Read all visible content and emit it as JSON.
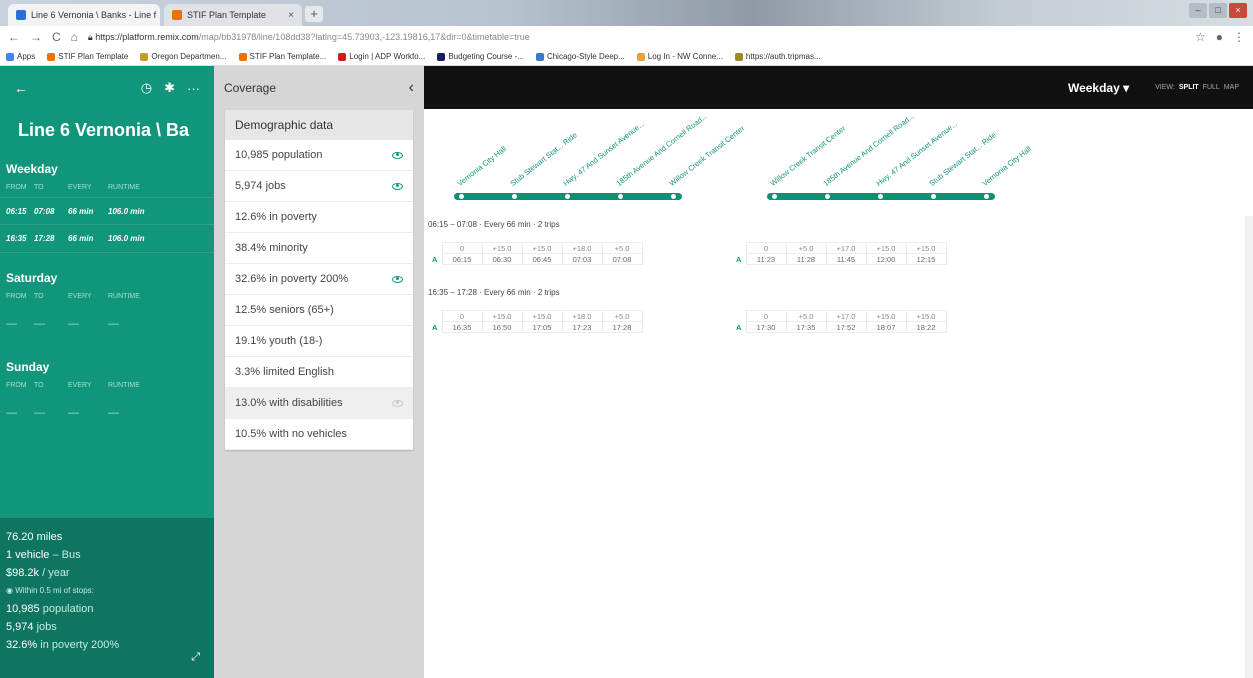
{
  "browser": {
    "tabs": [
      {
        "label": "Line 6 Vernonia \\ Banks - Line f",
        "close": "×"
      },
      {
        "label": "STIF Plan Template",
        "close": "×"
      }
    ],
    "new_tab": "+",
    "window_controls": [
      "–",
      "□",
      "×"
    ],
    "nav": {
      "back": "←",
      "forward": "→",
      "reload": "C",
      "home": "⌂"
    },
    "url_host": "https://platform.remix.com",
    "url_path": "/map/bb31978/line/108dd38?latlng=45.73903,-123.19816,17&dir=0&timetable=true",
    "bookmarks": [
      {
        "label": "Apps",
        "color": "#4285f4"
      },
      {
        "label": "STIF Plan Template",
        "color": "#e8710a"
      },
      {
        "label": "Oregon Departmen...",
        "color": "#c99a2e"
      },
      {
        "label": "STIF Plan Template...",
        "color": "#e8710a"
      },
      {
        "label": "Login | ADP Workfo...",
        "color": "#d01c1c"
      },
      {
        "label": "Budgeting Course -...",
        "color": "#1a1a66"
      },
      {
        "label": "Chicago-Style Deep...",
        "color": "#3b7bbf"
      },
      {
        "label": "Log In - NW Conne...",
        "color": "#e8a03a"
      },
      {
        "label": "https://auth.tripmas...",
        "color": "#9a8a2a"
      }
    ]
  },
  "left_panel": {
    "back_icon": "←",
    "clock_icon": "◷",
    "gear_icon": "✱",
    "more_icon": "···",
    "line_title": "Line 6 Vernonia \\ Ba",
    "columns": {
      "from": "FROM",
      "to": "TO",
      "every": "EVERY",
      "runtime": "RUNTIME"
    },
    "weekday": {
      "label": "Weekday",
      "trips": [
        {
          "from": "06:15",
          "to": "07:08",
          "every": "66 min",
          "runtime": "106.0 min"
        },
        {
          "from": "16:35",
          "to": "17:28",
          "every": "66 min",
          "runtime": "106.0 min"
        }
      ]
    },
    "saturday": {
      "label": "Saturday",
      "empty": "—"
    },
    "sunday": {
      "label": "Sunday",
      "empty": "—"
    },
    "summary": {
      "miles": "76.20 miles",
      "vehicle_count": "1 vehicle",
      "vehicle_type": " – Bus",
      "cost": "$98.2k",
      "cost_unit": " / year",
      "within": "Within 0.5 mi of stops:",
      "population_value": "10,985",
      "population_label": " population",
      "jobs_value": "5,974",
      "jobs_label": " jobs",
      "poverty_value": "32.6%",
      "poverty_label": " in poverty 200%",
      "expand_icon": "⤢"
    }
  },
  "coverage": {
    "title": "Coverage",
    "collapse_icon": "‹",
    "card_title": "Demographic data",
    "items": [
      {
        "label": "10,985 population",
        "eye": "on"
      },
      {
        "label": "5,974 jobs",
        "eye": "on"
      },
      {
        "label": "12.6% in poverty",
        "eye": "none"
      },
      {
        "label": "38.4% minority",
        "eye": "none"
      },
      {
        "label": "32.6% in poverty 200%",
        "eye": "on"
      },
      {
        "label": "12.5% seniors (65+)",
        "eye": "none"
      },
      {
        "label": "19.1% youth (18-)",
        "eye": "none"
      },
      {
        "label": "3.3% limited English",
        "eye": "none"
      },
      {
        "label": "13.0% with disabilities",
        "eye": "off"
      },
      {
        "label": "10.5% with no vehicles",
        "eye": "none"
      }
    ]
  },
  "main": {
    "day_selector": "Weekday",
    "dd_icon": "▾",
    "view_label": "VIEW:",
    "view_split": "SPLIT",
    "view_full": "FULL",
    "view_map": "MAP",
    "outbound_stops": [
      "Vernonia City Hall",
      "Stub Stewart Stat... Ride",
      "Hwy. 47 And Sunset Avenue...",
      "185th Avenue And Cornell Road...",
      "Willow Creek Transit Center"
    ],
    "inbound_stops": [
      "Willow Creek Transit Center",
      "185th Avenue And Cornell Road...",
      "Hwy. 47 And Sunset Avenue...",
      "Stub Stewart Stat... Ride",
      "Vernonia City Hall"
    ],
    "blocks": [
      {
        "header": "06:15 – 07:08 · Every 66 min · 2 trips",
        "label": "A",
        "out_offsets": [
          "0",
          "+15.0",
          "+15.0",
          "+18.0",
          "+5.0"
        ],
        "out_times": [
          "06:15",
          "06:30",
          "06:45",
          "07:03",
          "07:08"
        ],
        "in_offsets": [
          "0",
          "+5.0",
          "+17.0",
          "+15.0",
          "+15.0"
        ],
        "in_times": [
          "11:23",
          "11:28",
          "11:45",
          "12:00",
          "12:15"
        ]
      },
      {
        "header": "16:35 – 17:28 · Every 66 min · 2 trips",
        "label": "A",
        "out_offsets": [
          "0",
          "+15.0",
          "+15.0",
          "+18.0",
          "+5.0"
        ],
        "out_times": [
          "16:35",
          "16:50",
          "17:05",
          "17:23",
          "17:28"
        ],
        "in_offsets": [
          "0",
          "+5.0",
          "+17.0",
          "+15.0",
          "+15.0"
        ],
        "in_times": [
          "17:30",
          "17:35",
          "17:52",
          "18:07",
          "18:22"
        ]
      }
    ]
  },
  "colors": {
    "accent": "#11967c",
    "accent_dark": "#0d7560",
    "header_bg": "#111111"
  }
}
